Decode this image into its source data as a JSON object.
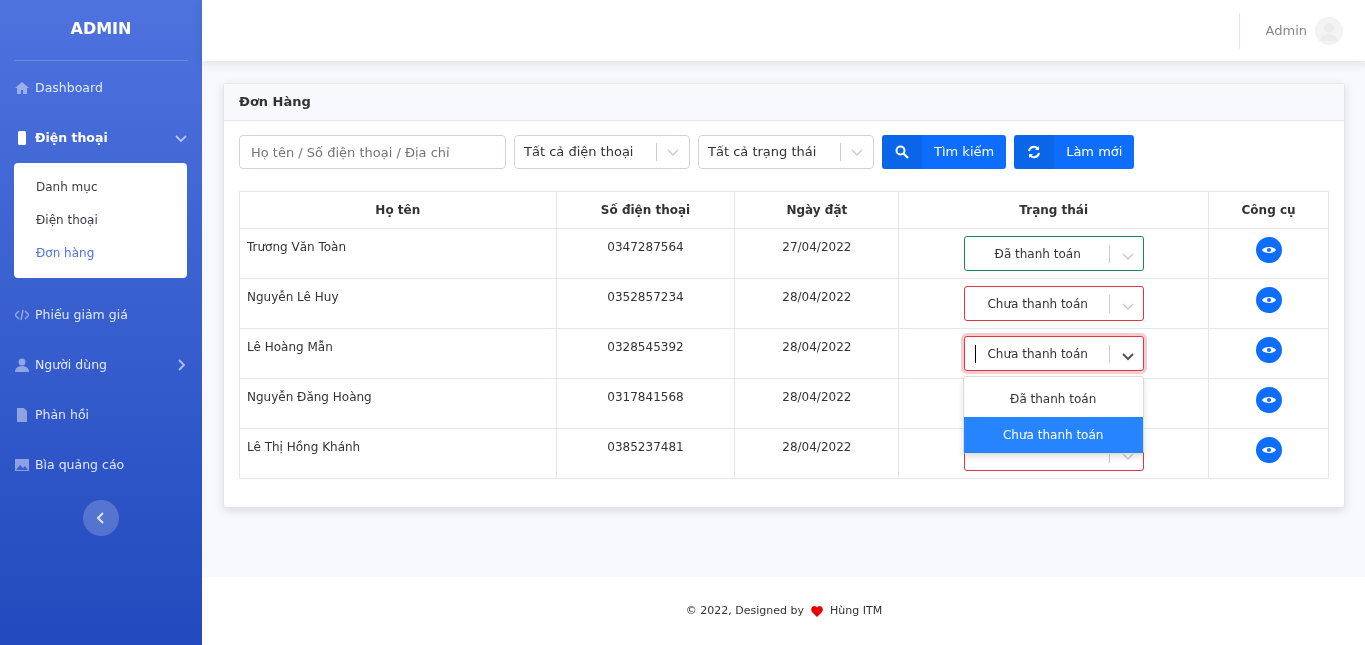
{
  "sidebar": {
    "brand": "ADMIN",
    "items": [
      {
        "label": "Dashboard",
        "selected": false
      },
      {
        "label": "Điện thoại",
        "selected": true,
        "expanded": true,
        "children": [
          {
            "label": "Danh mục",
            "selected": false
          },
          {
            "label": "Điện thoại",
            "selected": false
          },
          {
            "label": "Đơn hàng",
            "selected": true
          }
        ]
      },
      {
        "label": "Phiếu giảm giá",
        "selected": false
      },
      {
        "label": "Người dùng",
        "selected": false,
        "expanded": false
      },
      {
        "label": "Phản hồi",
        "selected": false
      },
      {
        "label": "Bìa quảng cáo",
        "selected": false
      }
    ]
  },
  "topbar": {
    "user": "Admin"
  },
  "card": {
    "title": "Đơn Hàng",
    "filters": {
      "search": {
        "placeholder": "Họ tên / Số điện thoại / Địa chỉ"
      },
      "phone_select": "Tất cả điện thoại",
      "status_select": "Tất cả trạng thái"
    },
    "buttons": [
      "Tìm kiếm",
      "Làm mới"
    ],
    "table": {
      "columns": [
        "Họ tên",
        "Số điện thoại",
        "Ngày đặt",
        "Trạng thái",
        "Công cụ"
      ],
      "rows": [
        {
          "name": "Trương Văn Toàn",
          "phone": "0347287564",
          "date": "27/04/2022",
          "status": {
            "text": "Đã thanh toán",
            "color": "#198754"
          }
        },
        {
          "name": "Nguyễn Lê Huy",
          "phone": "0352857234",
          "date": "28/04/2022",
          "status": {
            "text": "Chưa thanh toán",
            "color": "#dc3545"
          }
        },
        {
          "name": "Lê Hoàng Mẫn",
          "phone": "0328545392",
          "date": "28/04/2022",
          "status": {
            "text": "Chưa thanh toán",
            "color": "#dc3545",
            "open": true,
            "options": [
              {
                "label": "Đã thanh toán",
                "selected": false
              },
              {
                "label": "Chưa thanh toán",
                "selected": true
              }
            ]
          }
        },
        {
          "name": "Nguyễn Đăng Hoàng",
          "phone": "0317841568",
          "date": "28/04/2022"
        },
        {
          "name": "Lê Thị Hồng Khánh",
          "phone": "0385237481",
          "date": "28/04/2022",
          "status": {
            "color": "#dc3545"
          }
        }
      ]
    }
  },
  "footer": {
    "text": "© 2022, Designed by",
    "author": "Hùng ITM"
  }
}
